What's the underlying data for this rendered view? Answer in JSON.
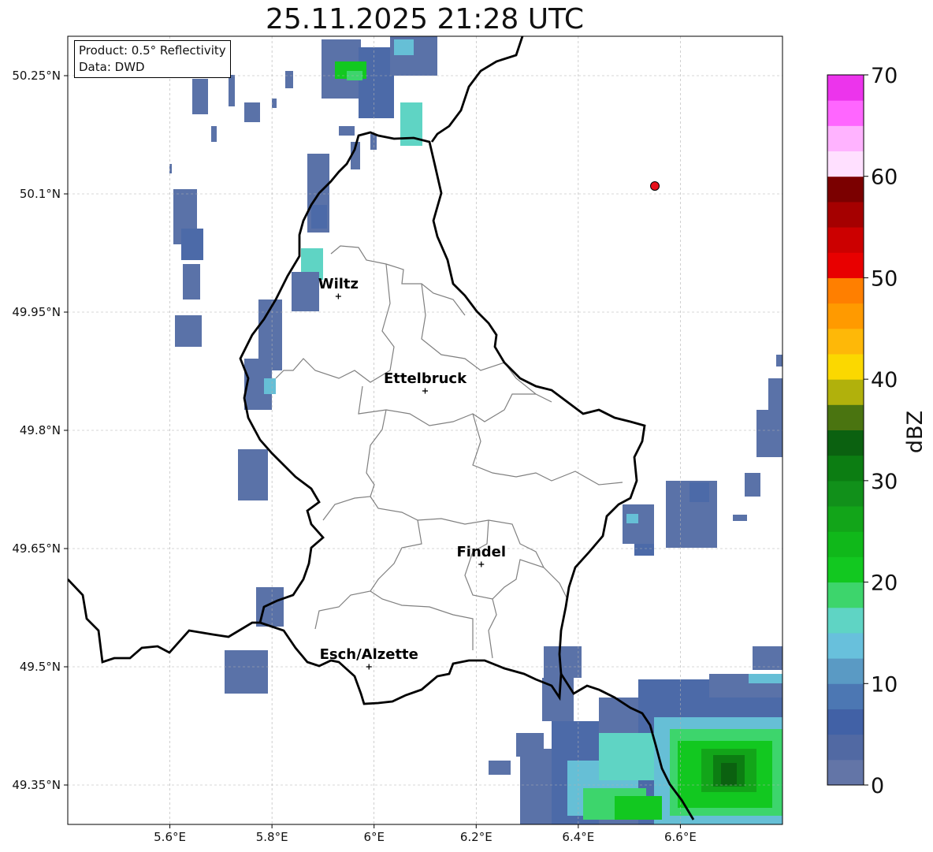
{
  "title": "25.11.2025 21:28 UTC",
  "info": {
    "product": "Product: 0.5° Reflectivity",
    "source": "Data: DWD"
  },
  "map": {
    "lon_range": [
      5.4,
      6.8
    ],
    "lat_range": [
      49.3,
      50.3
    ],
    "x_ticks": [
      {
        "value": 5.6,
        "label": "5.6°E"
      },
      {
        "value": 5.8,
        "label": "5.8°E"
      },
      {
        "value": 6.0,
        "label": "6°E"
      },
      {
        "value": 6.2,
        "label": "6.2°E"
      },
      {
        "value": 6.4,
        "label": "6.4°E"
      },
      {
        "value": 6.6,
        "label": "6.6°E"
      }
    ],
    "y_ticks": [
      {
        "value": 50.25,
        "label": "50.25°N"
      },
      {
        "value": 50.1,
        "label": "50.1°N"
      },
      {
        "value": 49.95,
        "label": "49.95°N"
      },
      {
        "value": 49.8,
        "label": "49.8°N"
      },
      {
        "value": 49.65,
        "label": "49.65°N"
      },
      {
        "value": 49.5,
        "label": "49.5°N"
      },
      {
        "value": 49.35,
        "label": "49.35°N"
      }
    ],
    "grid": true,
    "cities": [
      {
        "name": "Wiltz",
        "lon": 5.93,
        "lat": 49.97
      },
      {
        "name": "Ettelbruck",
        "lon": 6.1,
        "lat": 49.85
      },
      {
        "name": "Findel",
        "lon": 6.21,
        "lat": 49.63
      },
      {
        "name": "Esch/Alzette",
        "lon": 5.99,
        "lat": 49.5
      }
    ],
    "marker": {
      "lon": 6.55,
      "lat": 50.11,
      "color": "#e8101a"
    }
  },
  "colorbar": {
    "label": "dBZ",
    "min": 0,
    "max": 70,
    "ticks": [
      "0",
      "10",
      "20",
      "30",
      "40",
      "50",
      "60",
      "70"
    ],
    "colors": [
      "#6375a7",
      "#5169a3",
      "#4161a6",
      "#4c77b3",
      "#5a9ac4",
      "#68c0dc",
      "#5fd4c4",
      "#3dd56c",
      "#12c820",
      "#10b81a",
      "#12a519",
      "#11901a",
      "#0c7d12",
      "#0b6110",
      "#4a7410",
      "#b1b10c",
      "#fbd800",
      "#feb808",
      "#ff9a00",
      "#ff7f00",
      "#e80000",
      "#cc0000",
      "#a50000",
      "#7b0000",
      "#ffe0ff",
      "#ffb3ff",
      "#ff66ff",
      "#ec34ec"
    ]
  },
  "colors": {
    "border": "#000000",
    "cantons": "#808080",
    "grid": "#b0b0b0"
  }
}
